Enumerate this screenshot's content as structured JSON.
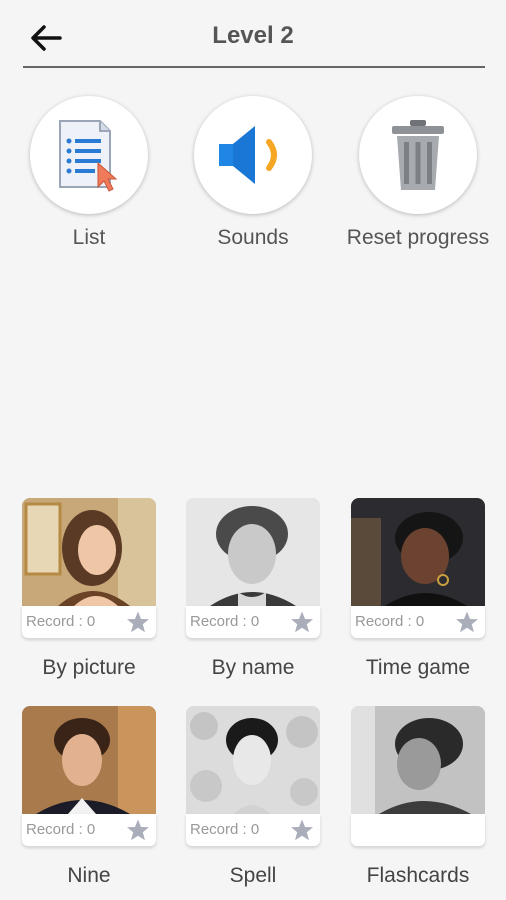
{
  "header": {
    "title": "Level 2"
  },
  "tools": [
    {
      "label": "List"
    },
    {
      "label": "Sounds"
    },
    {
      "label": "Reset progress"
    }
  ],
  "modes": [
    {
      "label": "By picture",
      "record": "Record : 0"
    },
    {
      "label": "By name",
      "record": "Record : 0"
    },
    {
      "label": "Time game",
      "record": "Record : 0"
    },
    {
      "label": "Nine",
      "record": "Record : 0"
    },
    {
      "label": "Spell",
      "record": "Record : 0"
    },
    {
      "label": "Flashcards"
    }
  ],
  "colors": {
    "star": "#a9aeba",
    "accent_blue": "#1f86e6",
    "accent_orange": "#f5a623"
  },
  "icons": {
    "back": "arrow-left-icon",
    "list": "list-document-icon",
    "sounds": "speaker-icon",
    "reset": "trash-can-icon",
    "star": "star-icon"
  }
}
